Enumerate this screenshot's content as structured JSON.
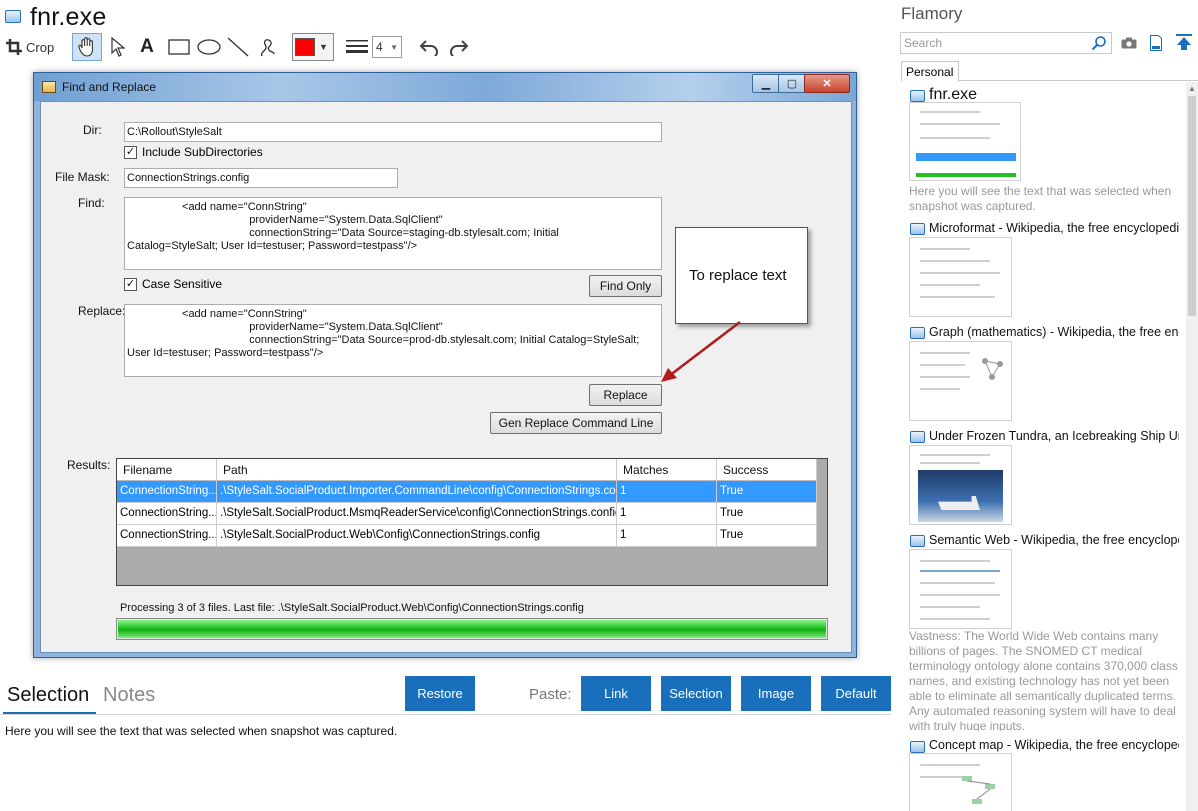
{
  "app": {
    "title": "fnr.exe"
  },
  "toolbar": {
    "crop_label": "Crop",
    "line_width_value": "4",
    "color": "#ff0000"
  },
  "dialog": {
    "title": "Find and Replace",
    "dir_label": "Dir:",
    "dir_value": "C:\\Rollout\\StyleSalt",
    "include_subdirs_label": "Include SubDirectories",
    "file_mask_label": "File Mask:",
    "file_mask_value": "ConnectionStrings.config",
    "find_label": "Find:",
    "find_value": "                  <add name=\"ConnString\"\n                                        providerName=\"System.Data.SqlClient\"\n                                        connectionString=\"Data Source=staging-db.stylesalt.com; Initial\nCatalog=StyleSalt; User Id=testuser; Password=testpass\"/>",
    "case_sensitive_label": "Case Sensitive",
    "find_only_label": "Find Only",
    "replace_label": "Replace:",
    "replace_value": "                  <add name=\"ConnString\"\n                                        providerName=\"System.Data.SqlClient\"\n                                        connectionString=\"Data Source=prod-db.stylesalt.com; Initial Catalog=StyleSalt;\nUser Id=testuser; Password=testpass\"/>",
    "replace_button_label": "Replace",
    "gen_command_label": "Gen Replace Command Line",
    "results_label": "Results:",
    "columns": [
      "Filename",
      "Path",
      "Matches",
      "Success"
    ],
    "rows": [
      {
        "filename": "ConnectionString...",
        "path": ".\\StyleSalt.SocialProduct.Importer.CommandLine\\config\\ConnectionStrings.config",
        "matches": "1",
        "success": "True"
      },
      {
        "filename": "ConnectionString...",
        "path": ".\\StyleSalt.SocialProduct.MsmqReaderService\\config\\ConnectionStrings.config",
        "matches": "1",
        "success": "True"
      },
      {
        "filename": "ConnectionString...",
        "path": ".\\StyleSalt.SocialProduct.Web\\Config\\ConnectionStrings.config",
        "matches": "1",
        "success": "True"
      }
    ],
    "status_text": "Processing 3 of 3 files.  Last file: .\\StyleSalt.SocialProduct.Web\\Config\\ConnectionStrings.config",
    "progress": 1.0
  },
  "callout": {
    "text": "To replace text"
  },
  "bottom": {
    "tabs": [
      "Selection",
      "Notes"
    ],
    "restore_label": "Restore",
    "paste_label": "Paste:",
    "paste_buttons": [
      "Link",
      "Selection",
      "Image",
      "Default"
    ],
    "selection_text": "Here you will see the text that was selected when snapshot was captured."
  },
  "sidebar": {
    "title": "Flamory",
    "search_placeholder": "Search",
    "tab_label": "Personal",
    "items": [
      {
        "title": "fnr.exe",
        "desc": "Here you will see the text that was selected when snapshot was captured."
      },
      {
        "title": "Microformat - Wikipedia, the free encyclopedia"
      },
      {
        "title": "Graph (mathematics) - Wikipedia, the free encyclopedia"
      },
      {
        "title": "Under Frozen Tundra, an Icebreaking Ship Uncovers"
      },
      {
        "title": "Semantic Web - Wikipedia, the free encyclopedia",
        "desc": "Vastness: The World Wide Web contains many billions of pages. The SNOMED CT medical terminology ontology alone contains 370,000 class names, and existing technology has not yet been able to eliminate all semantically duplicated terms. Any automated reasoning system will have to deal with truly huge inputs."
      },
      {
        "title": "Concept map - Wikipedia, the free encyclopedia"
      }
    ]
  },
  "colors": {
    "accent": "#1a6fbd",
    "selection_row": "#3399ff",
    "progress": "#22c022"
  }
}
